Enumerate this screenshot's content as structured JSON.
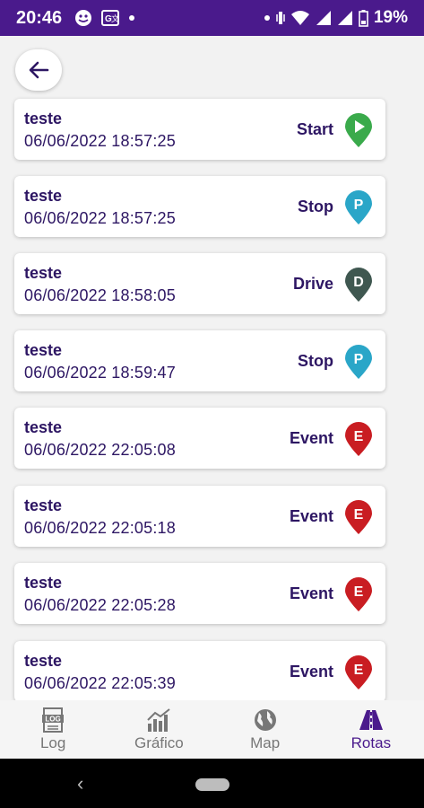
{
  "status_bar": {
    "time": "20:46",
    "battery": "19%"
  },
  "colors": {
    "primary": "#4a1a8c",
    "start": "#3aaa4b",
    "stop": "#2aa6c8",
    "drive": "#3f5750",
    "event": "#c91d22"
  },
  "items": [
    {
      "title": "teste",
      "datetime": "06/06/2022 18:57:25",
      "type": "Start",
      "pin_letter": "",
      "icon": "play-pin-icon"
    },
    {
      "title": "teste",
      "datetime": "06/06/2022 18:57:25",
      "type": "Stop",
      "pin_letter": "P",
      "icon": "stop-pin-icon"
    },
    {
      "title": "teste",
      "datetime": "06/06/2022 18:58:05",
      "type": "Drive",
      "pin_letter": "D",
      "icon": "drive-pin-icon"
    },
    {
      "title": "teste",
      "datetime": "06/06/2022 18:59:47",
      "type": "Stop",
      "pin_letter": "P",
      "icon": "stop-pin-icon"
    },
    {
      "title": "teste",
      "datetime": "06/06/2022 22:05:08",
      "type": "Event",
      "pin_letter": "E",
      "icon": "event-pin-icon"
    },
    {
      "title": "teste",
      "datetime": "06/06/2022 22:05:18",
      "type": "Event",
      "pin_letter": "E",
      "icon": "event-pin-icon"
    },
    {
      "title": "teste",
      "datetime": "06/06/2022 22:05:28",
      "type": "Event",
      "pin_letter": "E",
      "icon": "event-pin-icon"
    },
    {
      "title": "teste",
      "datetime": "06/06/2022 22:05:39",
      "type": "Event",
      "pin_letter": "E",
      "icon": "event-pin-icon"
    }
  ],
  "bottom_nav": [
    {
      "label": "Log",
      "icon": "log-icon",
      "active": false
    },
    {
      "label": "Gráfico",
      "icon": "chart-icon",
      "active": false
    },
    {
      "label": "Map",
      "icon": "globe-icon",
      "active": false
    },
    {
      "label": "Rotas",
      "icon": "road-icon",
      "active": true
    }
  ]
}
